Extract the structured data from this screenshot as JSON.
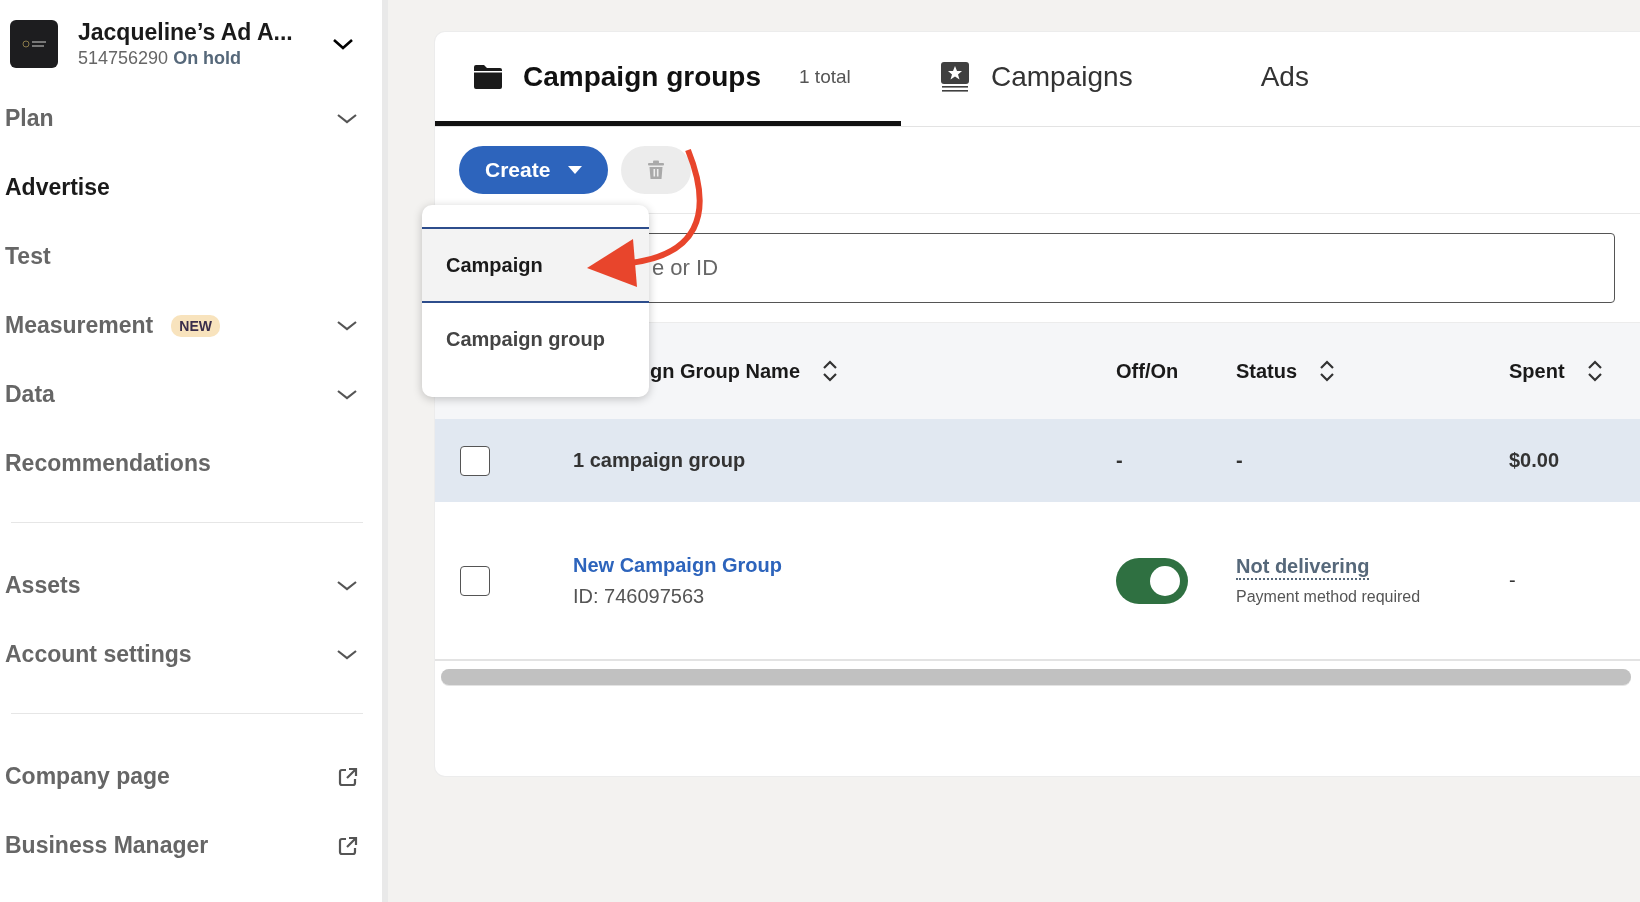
{
  "account": {
    "name": "Jacqueline’s Ad A...",
    "id": "514756290",
    "status": "On hold"
  },
  "sidebar": {
    "sections": [
      [
        {
          "label": "Plan",
          "kind": "expandable",
          "selected": false
        },
        {
          "label": "Advertise",
          "kind": "plain",
          "selected": true
        },
        {
          "label": "Test",
          "kind": "plain",
          "selected": false
        },
        {
          "label": "Measurement",
          "kind": "expandable",
          "selected": false,
          "badge": "NEW"
        },
        {
          "label": "Data",
          "kind": "expandable",
          "selected": false
        },
        {
          "label": "Recommendations",
          "kind": "plain",
          "selected": false
        }
      ],
      [
        {
          "label": "Assets",
          "kind": "expandable",
          "selected": false
        },
        {
          "label": "Account settings",
          "kind": "expandable",
          "selected": false
        }
      ],
      [
        {
          "label": "Company page",
          "kind": "external",
          "selected": false
        },
        {
          "label": "Business Manager",
          "kind": "external",
          "selected": false
        }
      ]
    ]
  },
  "tabs": [
    {
      "label": "Campaign groups",
      "count": "1 total",
      "selected": true
    },
    {
      "label": "Campaigns",
      "selected": false
    },
    {
      "label": "Ads",
      "selected": false
    }
  ],
  "toolbar": {
    "create": "Create",
    "delete_disabled": true
  },
  "create_menu": [
    {
      "label": "Campaign",
      "selected": true
    },
    {
      "label": "Campaign group",
      "selected": false
    }
  ],
  "search": {
    "placeholder": "e or ID"
  },
  "table": {
    "columns": [
      {
        "label": "gn Group Name",
        "sortable": true
      },
      {
        "label": "Off/On",
        "sortable": false
      },
      {
        "label": "Status",
        "sortable": true
      },
      {
        "label": "Spent",
        "sortable": true
      }
    ],
    "rows": [
      {
        "kind": "summary",
        "checked": false,
        "name": "1 campaign group",
        "off_on": "-",
        "status": "-",
        "spent": "$0.00"
      },
      {
        "kind": "item",
        "checked": false,
        "name": "New Campaign Group",
        "id": "ID: 746097563",
        "on": true,
        "status": "Not delivering",
        "status_detail": "Payment method required",
        "spent": "-"
      }
    ]
  }
}
